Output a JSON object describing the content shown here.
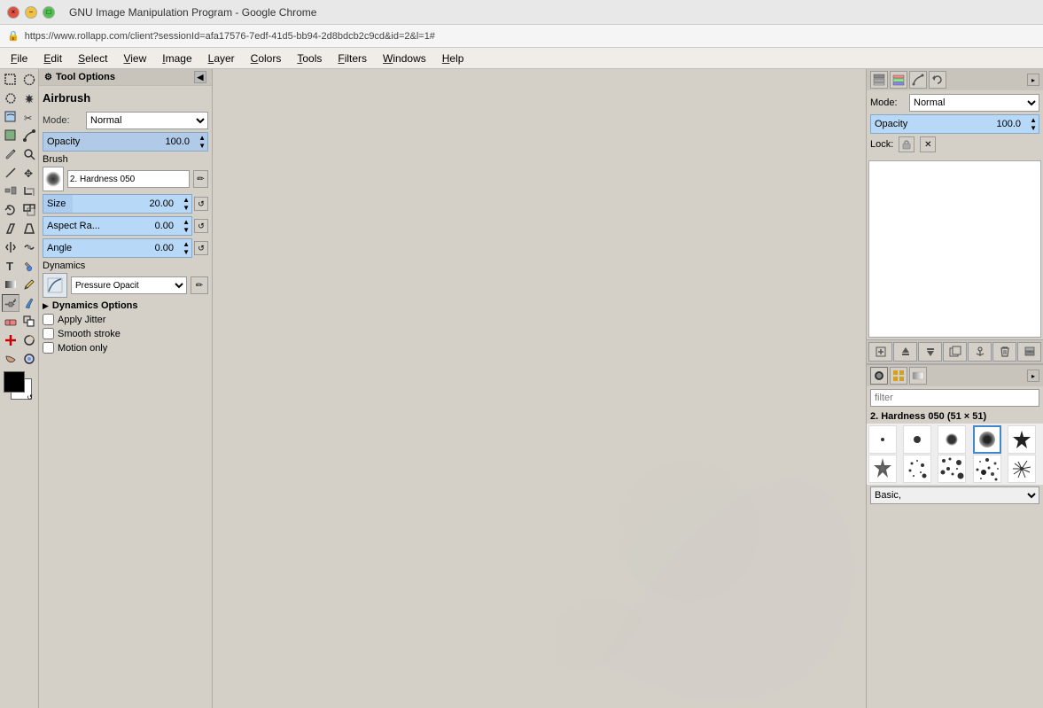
{
  "browser": {
    "title": "GNU Image Manipulation Program - Google Chrome",
    "address": "https://www.rollapp.com/client?sessionId=afa17576-7edf-41d5-bb94-2d8bdcb2c9cd&id=2&l=1#"
  },
  "menubar": {
    "items": [
      "File",
      "Edit",
      "Select",
      "View",
      "Image",
      "Layer",
      "Colors",
      "Tools",
      "Filters",
      "Windows",
      "Help"
    ]
  },
  "tool_options": {
    "panel_title": "Tool Options",
    "tool_name": "Airbrush",
    "mode_label": "Mode:",
    "mode_value": "Normal",
    "opacity_label": "Opacity",
    "opacity_value": "100.0",
    "brush_label": "Brush",
    "brush_name": "2. Hardness 050",
    "size_label": "Size",
    "size_value": "20.00",
    "aspect_label": "Aspect Ra...",
    "aspect_value": "0.00",
    "angle_label": "Angle",
    "angle_value": "0.00",
    "dynamics_label": "Dynamics",
    "dynamics_value": "Pressure Opacit",
    "dynamics_options_label": "Dynamics Options",
    "apply_jitter_label": "Apply Jitter",
    "smooth_stroke_label": "Smooth stroke",
    "motion_only_label": "Motion only"
  },
  "layer_panel": {
    "mode_label": "Mode:",
    "mode_value": "Normal",
    "opacity_label": "Opacity",
    "opacity_value": "100.0",
    "lock_label": "Lock:",
    "new_layer_label": "⊞",
    "raise_layer_label": "↑",
    "lower_layer_label": "↓",
    "duplicate_label": "⧉",
    "anchor_label": "⚓",
    "delete_label": "✕",
    "merge_label": "⊓"
  },
  "brush_panel": {
    "filter_placeholder": "filter",
    "selected_brush": "2. Hardness 050 (51 × 51)",
    "category_value": "Basic,",
    "brushes": [
      {
        "name": "circle-small",
        "type": "circle",
        "size": 4
      },
      {
        "name": "circle-medium",
        "type": "circle",
        "size": 8
      },
      {
        "name": "circle-large-soft",
        "type": "soft-circle",
        "size": 14
      },
      {
        "name": "circle-xlarge",
        "type": "circle",
        "size": 20
      },
      {
        "name": "star",
        "type": "star",
        "size": 16
      },
      {
        "name": "star-fancy",
        "type": "fancy-star",
        "size": 18
      },
      {
        "name": "dots-pattern",
        "type": "dots",
        "size": 14
      },
      {
        "name": "scatter1",
        "type": "scatter",
        "size": 12
      },
      {
        "name": "scatter2",
        "type": "scatter",
        "size": 14
      },
      {
        "name": "scatter3",
        "type": "scatter",
        "size": 16
      }
    ]
  },
  "icons": {
    "pencil": "✏",
    "eraser": "⌫",
    "airbrush": "🖌",
    "select_rect": "▭",
    "select_ellipse": "◯",
    "select_free": "⌒",
    "move": "✥",
    "zoom": "🔍",
    "crop": "⊹",
    "rotate": "↻",
    "shear": "◇",
    "perspective": "⬡",
    "flip": "↔",
    "text": "T",
    "fill": "🪣",
    "gradient": "▦",
    "path": "✒",
    "smudge": "◌",
    "dodge": "☀",
    "heal": "✚",
    "clone": "❐",
    "measure": "📏",
    "color_pick": "💉",
    "align": "⊞",
    "free_select": "⌗",
    "fuzzy": "✱",
    "scissors": "✂",
    "foreground": "■",
    "background": "□"
  }
}
